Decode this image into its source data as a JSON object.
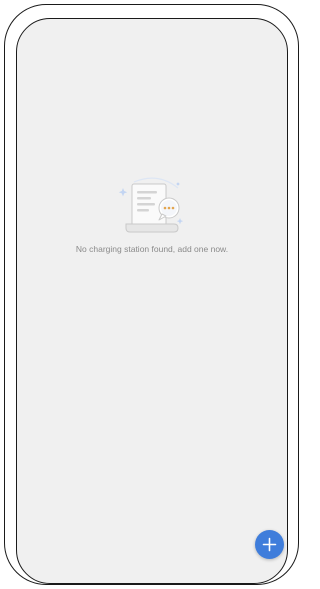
{
  "empty_state": {
    "icon": "empty-document-chat-icon",
    "message": "No charging station found, add one now."
  },
  "fab": {
    "icon": "plus-icon",
    "color": "#3f7ddb"
  },
  "colors": {
    "screen_background": "#f0f0f0",
    "message_text": "#8a8a8a",
    "accent": "#3f7ddb"
  }
}
